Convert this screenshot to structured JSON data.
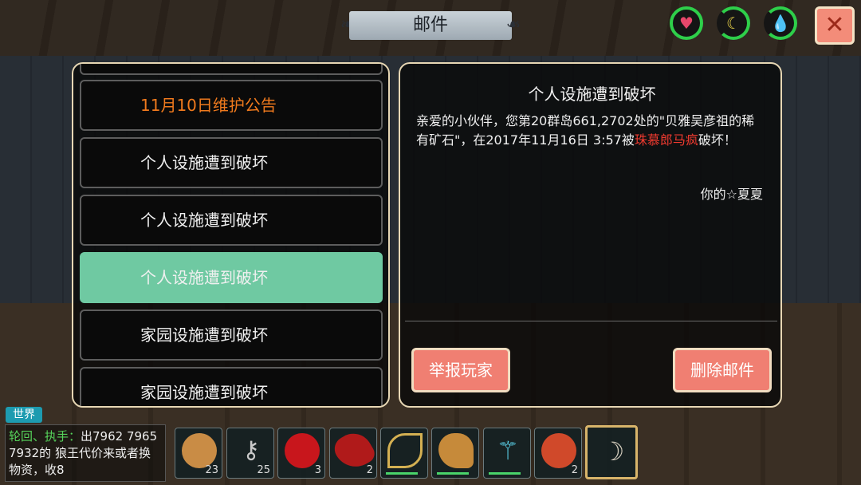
{
  "title": "邮件",
  "status_icons": [
    {
      "name": "heart-icon",
      "color": "#e8476b"
    },
    {
      "name": "hunger-icon",
      "color": "#e8d24a"
    },
    {
      "name": "water-icon",
      "color": "#3fc3e6"
    }
  ],
  "close_label": "✕",
  "mail_list": [
    {
      "label": "11月10日维护公告",
      "color": "#f07a1d"
    },
    {
      "label": "个人设施遭到破坏"
    },
    {
      "label": "个人设施遭到破坏"
    },
    {
      "label": "个人设施遭到破坏",
      "selected": true
    },
    {
      "label": "家园设施遭到破坏"
    },
    {
      "label": "家园设施遭到破坏"
    }
  ],
  "mail": {
    "subject": "个人设施遭到破坏",
    "body_prefix": "亲爱的小伙伴，您第20群岛661,2702处的\"贝雅吴彦祖的稀有矿石\"，在2017年11月16日 3:57被",
    "body_highlight": "珠慕郎马疯",
    "body_suffix": "破坏！",
    "signature": "你的☆夏夏"
  },
  "buttons": {
    "report": "举报玩家",
    "delete": "删除邮件"
  },
  "chat": {
    "tab_label": "世界",
    "sender": "轮回、执手：",
    "message": "出7962 7965 7932的 狼王代价来或者换物资，收8"
  },
  "hotbar": [
    {
      "name": "dumpling-steamer-icon",
      "count": "23"
    },
    {
      "name": "keys-icon",
      "count": "25"
    },
    {
      "name": "apple-icon",
      "count": "3"
    },
    {
      "name": "chili-pepper-icon",
      "count": "2"
    },
    {
      "name": "golden-bow-icon",
      "count": ""
    },
    {
      "name": "horn-icon",
      "count": ""
    },
    {
      "name": "crystal-staff-icon",
      "count": ""
    },
    {
      "name": "armor-icon",
      "count": "2"
    },
    {
      "name": "curved-blade-icon",
      "count": ""
    }
  ]
}
